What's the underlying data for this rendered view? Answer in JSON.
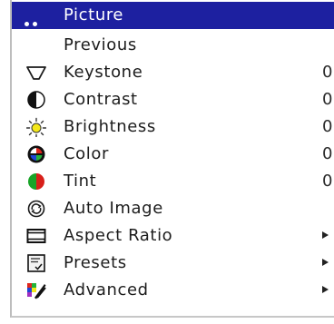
{
  "menu": {
    "items": [
      {
        "label": "Picture",
        "icon": "dots-icon"
      },
      {
        "label": "Previous",
        "icon": ""
      },
      {
        "label": "Keystone",
        "icon": "keystone-icon",
        "value": "0"
      },
      {
        "label": "Contrast",
        "icon": "contrast-icon",
        "value": "0"
      },
      {
        "label": "Brightness",
        "icon": "brightness-icon",
        "value": "0"
      },
      {
        "label": "Color",
        "icon": "color-icon",
        "value": "0"
      },
      {
        "label": "Tint",
        "icon": "tint-icon",
        "value": "0"
      },
      {
        "label": "Auto Image",
        "icon": "auto-image-icon"
      },
      {
        "label": "Aspect Ratio",
        "icon": "aspect-ratio-icon",
        "submenu": true
      },
      {
        "label": "Presets",
        "icon": "presets-icon",
        "submenu": true
      },
      {
        "label": "Advanced",
        "icon": "advanced-icon",
        "submenu": true
      }
    ],
    "selected_index": 0,
    "colors": {
      "highlight": "#1d20a0",
      "text": "#1c1c1c",
      "selected_text": "#ffffff"
    }
  }
}
